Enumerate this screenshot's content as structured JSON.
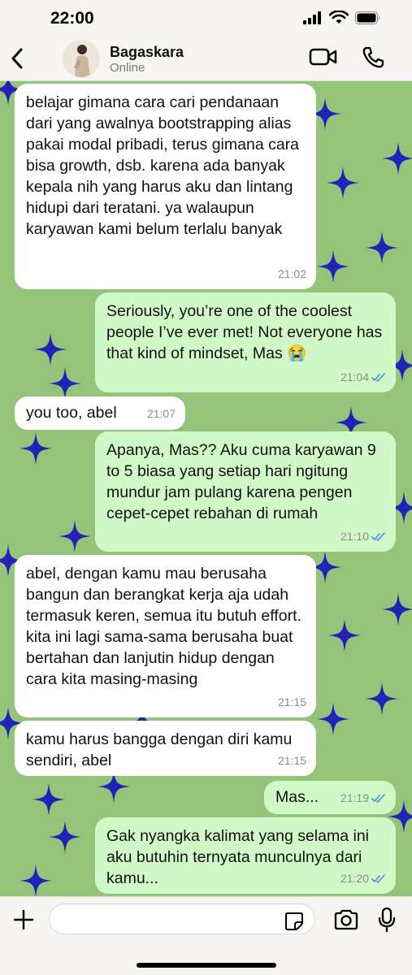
{
  "status_bar": {
    "time": "22:00"
  },
  "header": {
    "name": "Bagaskara",
    "status": "Online"
  },
  "colors": {
    "chat_bg": "#94c37a",
    "star": "#2222b8",
    "bubble_in": "#ffffff",
    "bubble_out": "#d1f9c7",
    "read_tick": "#4a90e2"
  },
  "messages": [
    {
      "direction": "incoming",
      "text": "belajar gimana cara cari pendanaan dari yang awalnya bootstrapping alias pakai modal pribadi, terus gimana cara bisa growth, dsb. karena ada banyak kepala nih yang harus aku dan lintang hidupi dari teratani. ya walaupun karyawan kami belum terlalu banyak",
      "time": "21:02"
    },
    {
      "direction": "outgoing",
      "text": "Seriously, you’re one of the coolest people I’ve ever met! Not everyone has that kind of mindset, Mas 😭",
      "time": "21:04",
      "read": true
    },
    {
      "direction": "incoming",
      "text": "you too, abel",
      "time": "21:07"
    },
    {
      "direction": "outgoing",
      "text": "Apanya, Mas?? Aku cuma karyawan 9 to 5 biasa yang setiap hari ngitung mundur jam pulang karena pengen cepet-cepet rebahan di rumah",
      "time": "21:10",
      "read": true
    },
    {
      "direction": "incoming",
      "text": "abel, dengan kamu mau berusaha bangun dan berangkat kerja aja udah termasuk keren, semua itu butuh effort. kita ini lagi sama-sama berusaha buat bertahan dan lanjutin hidup dengan cara kita masing-masing",
      "time": "21:15"
    },
    {
      "direction": "incoming",
      "text": "kamu harus bangga dengan diri kamu sendiri, abel",
      "time": "21:15"
    },
    {
      "direction": "outgoing",
      "text": "Mas...",
      "time": "21:19",
      "read": true
    },
    {
      "direction": "outgoing",
      "text": "Gak nyangka kalimat yang selama ini aku butuhin ternyata munculnya dari kamu...",
      "time": "21:20",
      "read": true
    }
  ],
  "composer": {
    "value": "",
    "placeholder": ""
  },
  "icons": [
    "chevron-left-icon",
    "video-camera-icon",
    "phone-icon",
    "plus-icon",
    "sticker-icon",
    "camera-icon",
    "microphone-icon",
    "signal-icon",
    "wifi-icon",
    "battery-icon"
  ]
}
